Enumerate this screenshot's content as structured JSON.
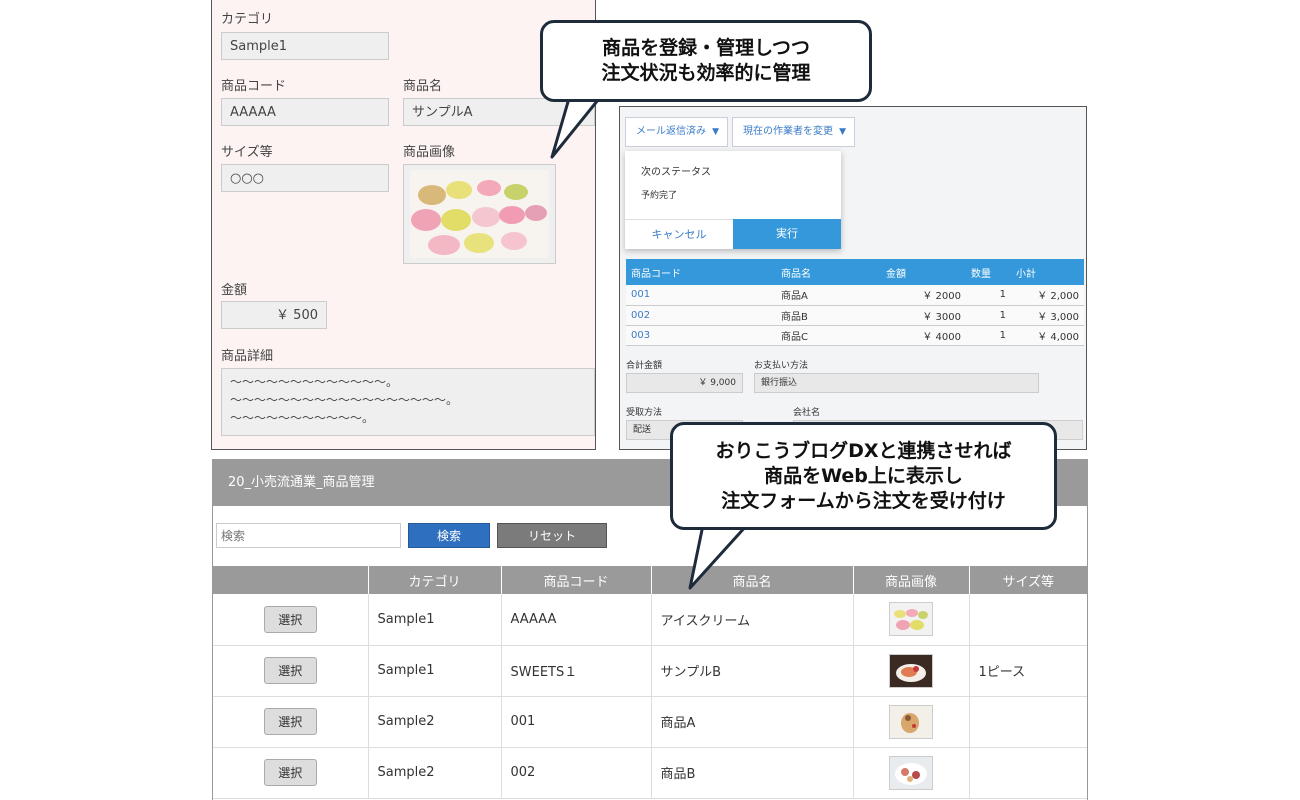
{
  "product_form": {
    "category_label": "カテゴリ",
    "category_value": "Sample1",
    "code_label": "商品コード",
    "code_value": "AAAAA",
    "name_label": "商品名",
    "name_value": "サンプルA",
    "size_label": "サイズ等",
    "size_value": "○○○",
    "image_label": "商品画像",
    "price_label": "金額",
    "price_value": "￥ 500",
    "detail_label": "商品詳細",
    "detail_value": "〜〜〜〜〜〜〜〜〜〜〜〜〜。\n〜〜〜〜〜〜〜〜〜〜〜〜〜〜〜〜〜〜。\n〜〜〜〜〜〜〜〜〜〜〜。"
  },
  "order_panel": {
    "status_button": "メール返信済み",
    "assignee_button": "現在の作業者を変更",
    "next_status_label": "次のステータス",
    "next_status_value": "予約完了",
    "cancel_label": "キャンセル",
    "execute_label": "実行",
    "table_headers": [
      "商品コード",
      "商品名",
      "金額",
      "数量",
      "小計"
    ],
    "rows": [
      {
        "code": "001",
        "name": "商品A",
        "price": "￥ 2000",
        "qty": "1",
        "subtotal": "￥ 2,000"
      },
      {
        "code": "002",
        "name": "商品B",
        "price": "￥ 3000",
        "qty": "1",
        "subtotal": "￥ 3,000"
      },
      {
        "code": "003",
        "name": "商品C",
        "price": "￥ 4000",
        "qty": "1",
        "subtotal": "￥ 4,000"
      }
    ],
    "total_label": "合計金額",
    "total_value": "￥ 9,000",
    "payment_label": "お支払い方法",
    "payment_value": "銀行振込",
    "receive_label": "受取方法",
    "receive_value": "配送",
    "company_label": "会社名"
  },
  "product_list": {
    "title": "20_小売流通業_商品管理",
    "search_placeholder": "検索",
    "search_button": "検索",
    "reset_button": "リセット",
    "headers": [
      "",
      "カテゴリ",
      "商品コード",
      "商品名",
      "商品画像",
      "サイズ等"
    ],
    "select_label": "選択",
    "rows": [
      {
        "category": "Sample1",
        "code": "AAAAA",
        "name": "アイスクリーム",
        "size": ""
      },
      {
        "category": "Sample1",
        "code": "SWEETS１",
        "name": "サンプルB",
        "size": "1ピース"
      },
      {
        "category": "Sample2",
        "code": "001",
        "name": "商品A",
        "size": ""
      },
      {
        "category": "Sample2",
        "code": "002",
        "name": "商品B",
        "size": ""
      }
    ]
  },
  "callouts": {
    "top": [
      "商品を登録・管理しつつ",
      "注文状況も効率的に管理"
    ],
    "bottom": [
      "おりこうブログDXと連携させれば",
      "商品をWeb上に表示し",
      "注文フォームから注文を受け付け"
    ]
  },
  "colors": {
    "accent_blue": "#3498db",
    "header_gray": "#9a9a9a",
    "form_bg": "#fdf3f3"
  }
}
